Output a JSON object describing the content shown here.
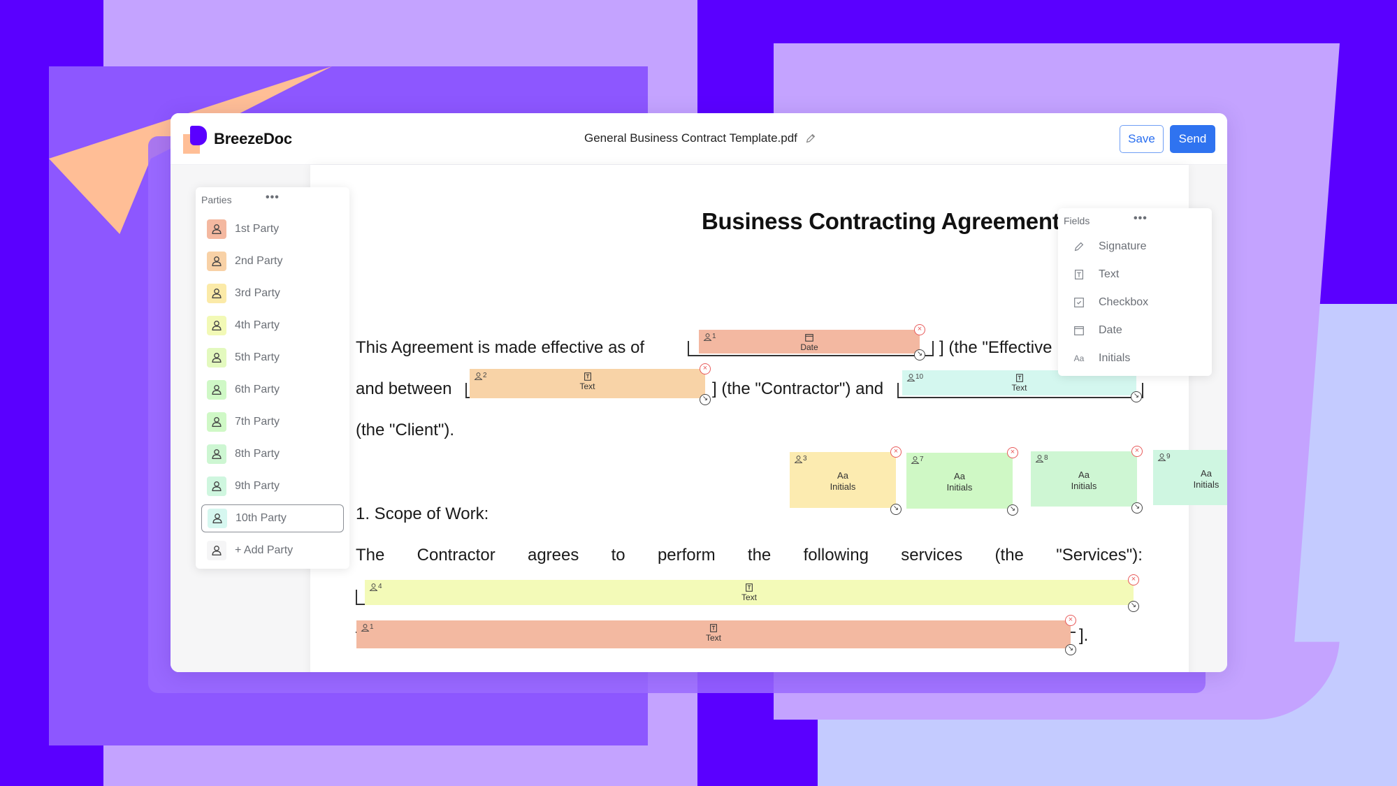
{
  "app": {
    "brand": "BreezeDoc",
    "document_title": "General Business Contract Template.pdf",
    "save_label": "Save",
    "send_label": "Send"
  },
  "parties": {
    "title": "Parties",
    "menu": "•••",
    "items": [
      {
        "label": "1st Party",
        "color": "#f4b8a0"
      },
      {
        "label": "2nd Party",
        "color": "#f8d1a6"
      },
      {
        "label": "3rd Party",
        "color": "#fbeaa8"
      },
      {
        "label": "4th Party",
        "color": "#f2f9b6"
      },
      {
        "label": "5th Party",
        "color": "#e3f9be"
      },
      {
        "label": "6th Party",
        "color": "#cff8c6"
      },
      {
        "label": "7th Party",
        "color": "#cff8c6"
      },
      {
        "label": "8th Party",
        "color": "#cdf6d2"
      },
      {
        "label": "9th Party",
        "color": "#cff6df"
      },
      {
        "label": "10th Party",
        "color": "#d6f7f0",
        "selected": true
      }
    ],
    "add_label": "+ Add Party"
  },
  "fields": {
    "title": "Fields",
    "menu": "•••",
    "items": [
      {
        "label": "Signature",
        "icon": "pencil-icon"
      },
      {
        "label": "Text",
        "icon": "text-field-icon"
      },
      {
        "label": "Checkbox",
        "icon": "checkbox-icon"
      },
      {
        "label": "Date",
        "icon": "calendar-icon"
      },
      {
        "label": "Initials",
        "icon": "initials-icon",
        "glyph": "Aa"
      }
    ]
  },
  "document": {
    "heading": "Business Contracting Agreement",
    "line1_a": "This Agreement is made effective as of",
    "line1_b": "] (the \"Effective",
    "line2_a": "and between",
    "line2_b": "] (the \"Contractor\") and",
    "line3": "(the \"Client\").",
    "section1": "1. Scope of Work:",
    "line4_words": [
      "The",
      "Contractor",
      "agrees",
      "to",
      "perform",
      "the",
      "following",
      "services",
      "(the",
      "\"Services\"):"
    ],
    "end_punct": "].",
    "open_bracket": "["
  },
  "placed_fields": [
    {
      "type": "Date",
      "party": "1",
      "color": "#f3b8a1"
    },
    {
      "type": "Text",
      "party": "2",
      "color": "#f8d3a7"
    },
    {
      "type": "Text",
      "party": "10",
      "color": "#d4f7ef"
    },
    {
      "type": "Initials",
      "glyph": "Aa",
      "party": "3",
      "color": "#fcebb0"
    },
    {
      "type": "Initials",
      "glyph": "Aa",
      "party": "7",
      "color": "#cff8c5"
    },
    {
      "type": "Initials",
      "glyph": "Aa",
      "party": "8",
      "color": "#cef6d3"
    },
    {
      "type": "Initials",
      "glyph": "Aa",
      "party": "9",
      "color": "#cff6e1"
    },
    {
      "type": "Text",
      "party": "4",
      "color": "#f3fab8"
    },
    {
      "type": "Text",
      "party": "1",
      "color": "#f3b9a1"
    }
  ],
  "icons": {
    "delete": "×",
    "resize": "↘"
  }
}
